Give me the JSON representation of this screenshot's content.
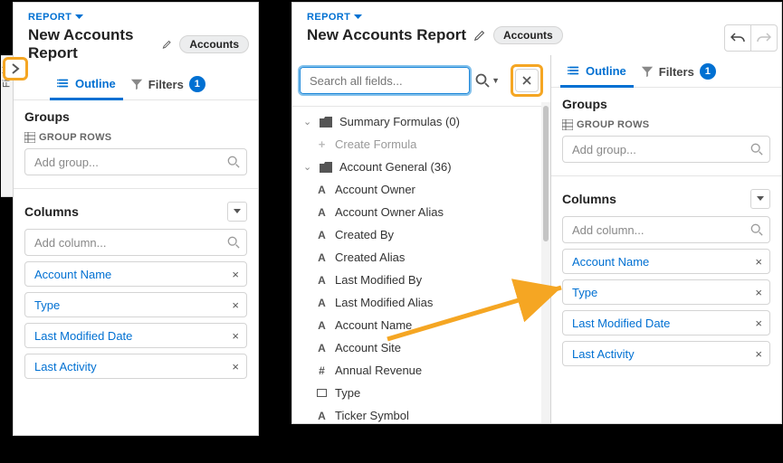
{
  "header": {
    "report_label": "REPORT",
    "title": "New Accounts Report",
    "entity_chip": "Accounts"
  },
  "tabs": {
    "outline": "Outline",
    "filters": "Filters",
    "filters_count": "1"
  },
  "fields_tab_label": "Fields",
  "groups": {
    "title": "Groups",
    "group_rows_label": "GROUP ROWS",
    "placeholder": "Add group..."
  },
  "columns": {
    "title": "Columns",
    "placeholder": "Add column...",
    "items": [
      "Account Name",
      "Type",
      "Last Modified Date",
      "Last Activity"
    ]
  },
  "search": {
    "placeholder": "Search all fields..."
  },
  "fields_tree": {
    "summary": "Summary Formulas (0)",
    "create_formula": "Create Formula",
    "account_general": "Account General (36)",
    "items": [
      {
        "icon": "A",
        "label": "Account Owner"
      },
      {
        "icon": "A",
        "label": "Account Owner Alias"
      },
      {
        "icon": "A",
        "label": "Created By"
      },
      {
        "icon": "A",
        "label": "Created Alias"
      },
      {
        "icon": "A",
        "label": "Last Modified By"
      },
      {
        "icon": "A",
        "label": "Last Modified Alias"
      },
      {
        "icon": "A",
        "label": "Account Name"
      },
      {
        "icon": "A",
        "label": "Account Site"
      },
      {
        "icon": "#",
        "label": "Annual Revenue"
      },
      {
        "icon": "box",
        "label": "Type"
      },
      {
        "icon": "A",
        "label": "Ticker Symbol"
      }
    ]
  }
}
